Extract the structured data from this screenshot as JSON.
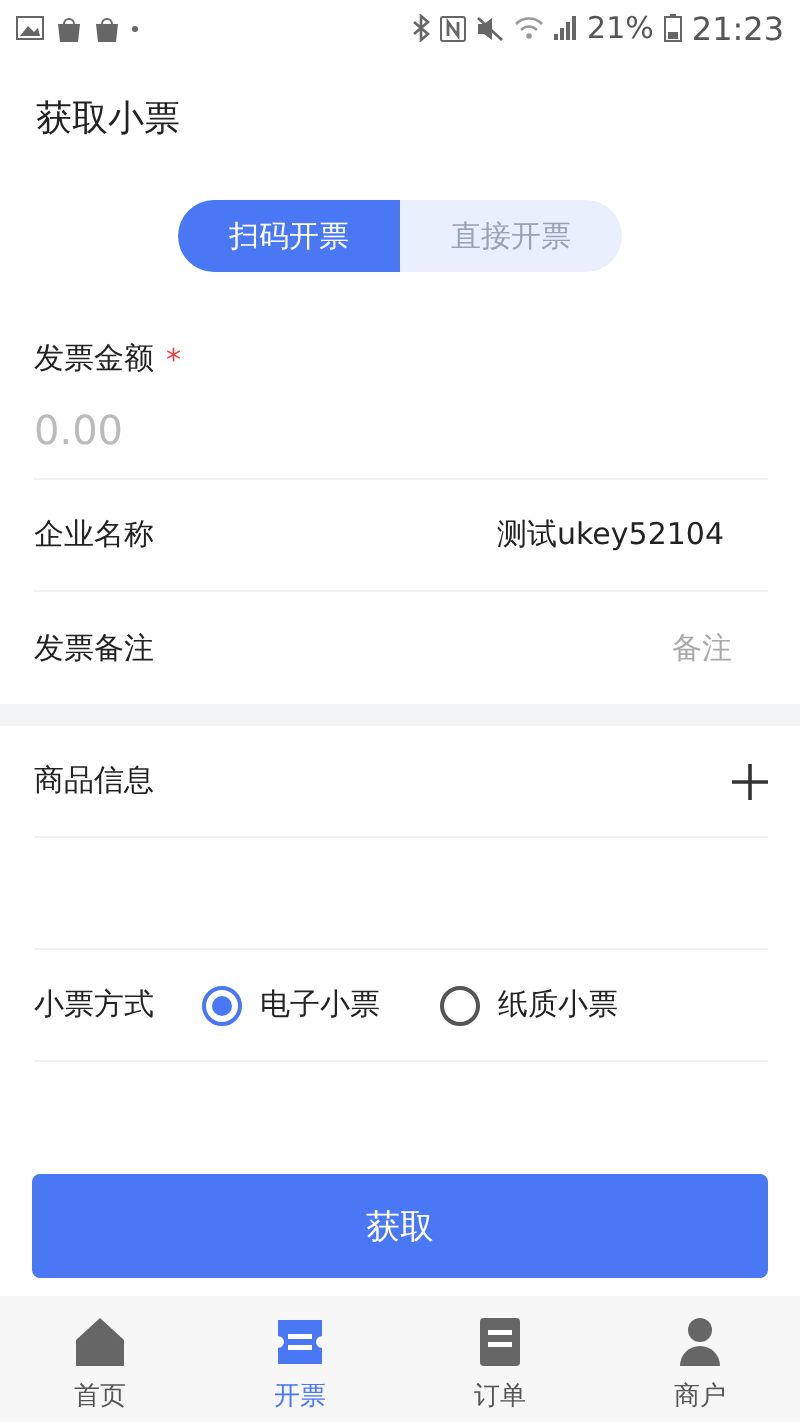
{
  "status_bar": {
    "battery": "21%",
    "time": "21:23"
  },
  "header": {
    "title": "获取小票"
  },
  "segments": [
    {
      "label": "扫码开票",
      "selected": true
    },
    {
      "label": "直接开票",
      "selected": false
    }
  ],
  "amount": {
    "label": "发票金额",
    "required_mark": "*",
    "placeholder": "0.00"
  },
  "company": {
    "label": "企业名称",
    "value": "测试ukey52104"
  },
  "remark": {
    "label": "发票备注",
    "placeholder": "备注"
  },
  "goods": {
    "label": "商品信息"
  },
  "receipt_type": {
    "label": "小票方式",
    "options": [
      {
        "label": "电子小票",
        "selected": true
      },
      {
        "label": "纸质小票",
        "selected": false
      }
    ]
  },
  "submit": {
    "label": "获取"
  },
  "tab_bar": [
    {
      "label": "首页",
      "selected": false
    },
    {
      "label": "开票",
      "selected": true
    },
    {
      "label": "订单",
      "selected": false
    },
    {
      "label": "商户",
      "selected": false
    }
  ]
}
